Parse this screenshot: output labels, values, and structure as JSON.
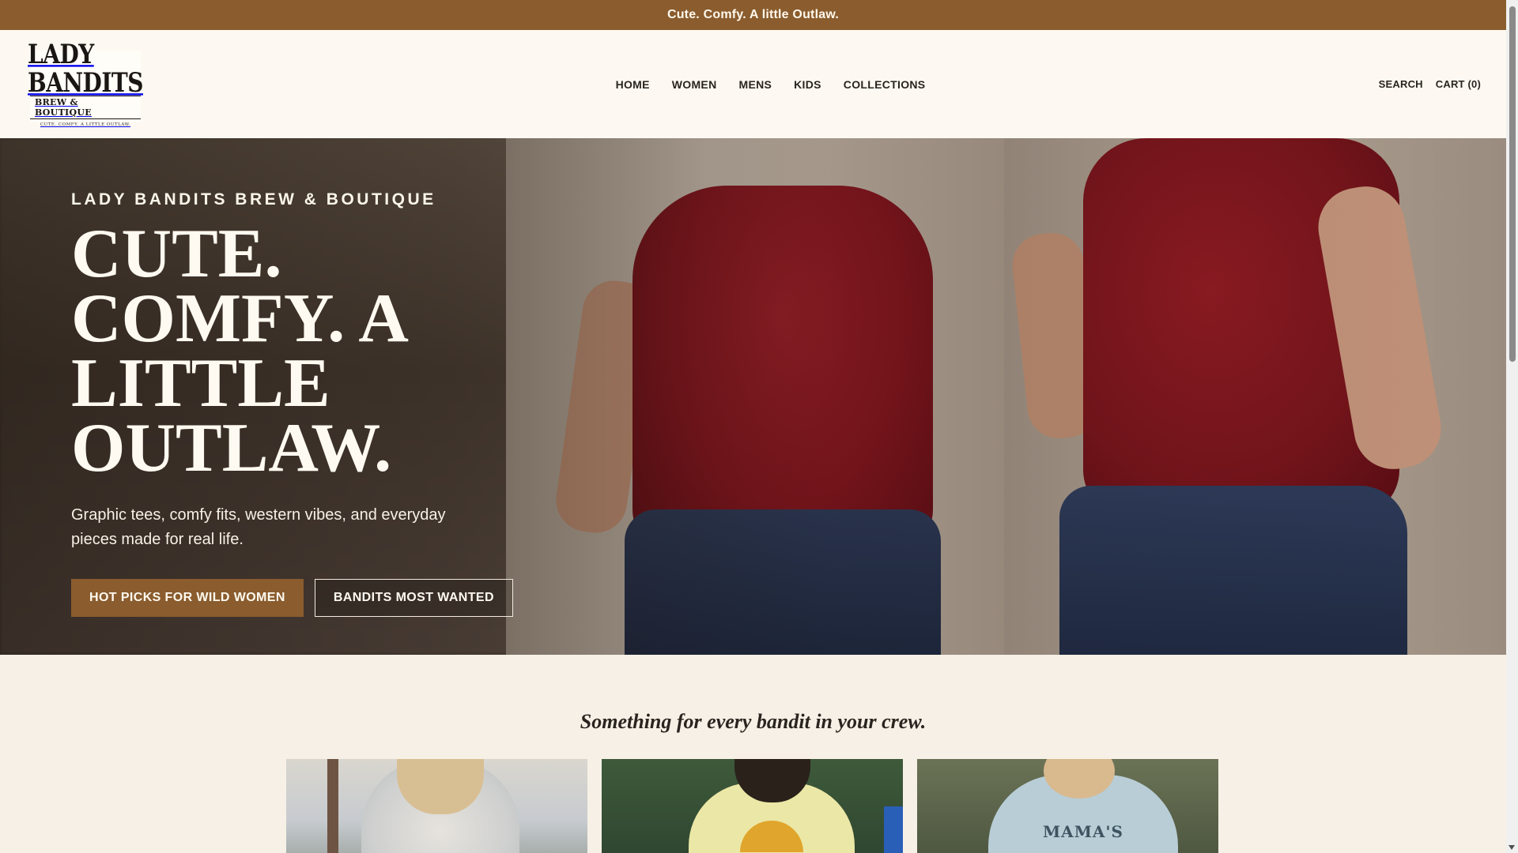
{
  "announcement": {
    "text": "Cute. Comfy. A little Outlaw."
  },
  "header": {
    "logo": {
      "line1": "LADY BANDITS",
      "line2": "BREW & BOUTIQUE",
      "tagline": "CUTE. COMFY. A LITTLE OUTLAW."
    },
    "nav": [
      {
        "label": "HOME"
      },
      {
        "label": "WOMEN"
      },
      {
        "label": "MENS"
      },
      {
        "label": "KIDS"
      },
      {
        "label": "COLLECTIONS"
      }
    ],
    "search_label": "SEARCH",
    "cart_label": "CART (0)"
  },
  "hero": {
    "eyebrow": "LADY BANDITS BREW & BOUTIQUE",
    "headline": "CUTE. COMFY. A LITTLE OUTLAW.",
    "subtext": "Graphic tees, comfy fits, western vibes, and everyday pieces made for real life.",
    "primary_cta": "HOT PICKS FOR WILD WOMEN",
    "secondary_cta": "BANDITS MOST WANTED"
  },
  "collections": {
    "title": "Something for every bandit in your crew.",
    "cards": [
      {
        "print_text": ""
      },
      {
        "print_text": ""
      },
      {
        "print_text": "MAMA'S"
      }
    ]
  },
  "colors": {
    "accent": "#8a5c2e",
    "header_bg": "#fdf9f2",
    "page_bg": "#f6f0e6"
  }
}
